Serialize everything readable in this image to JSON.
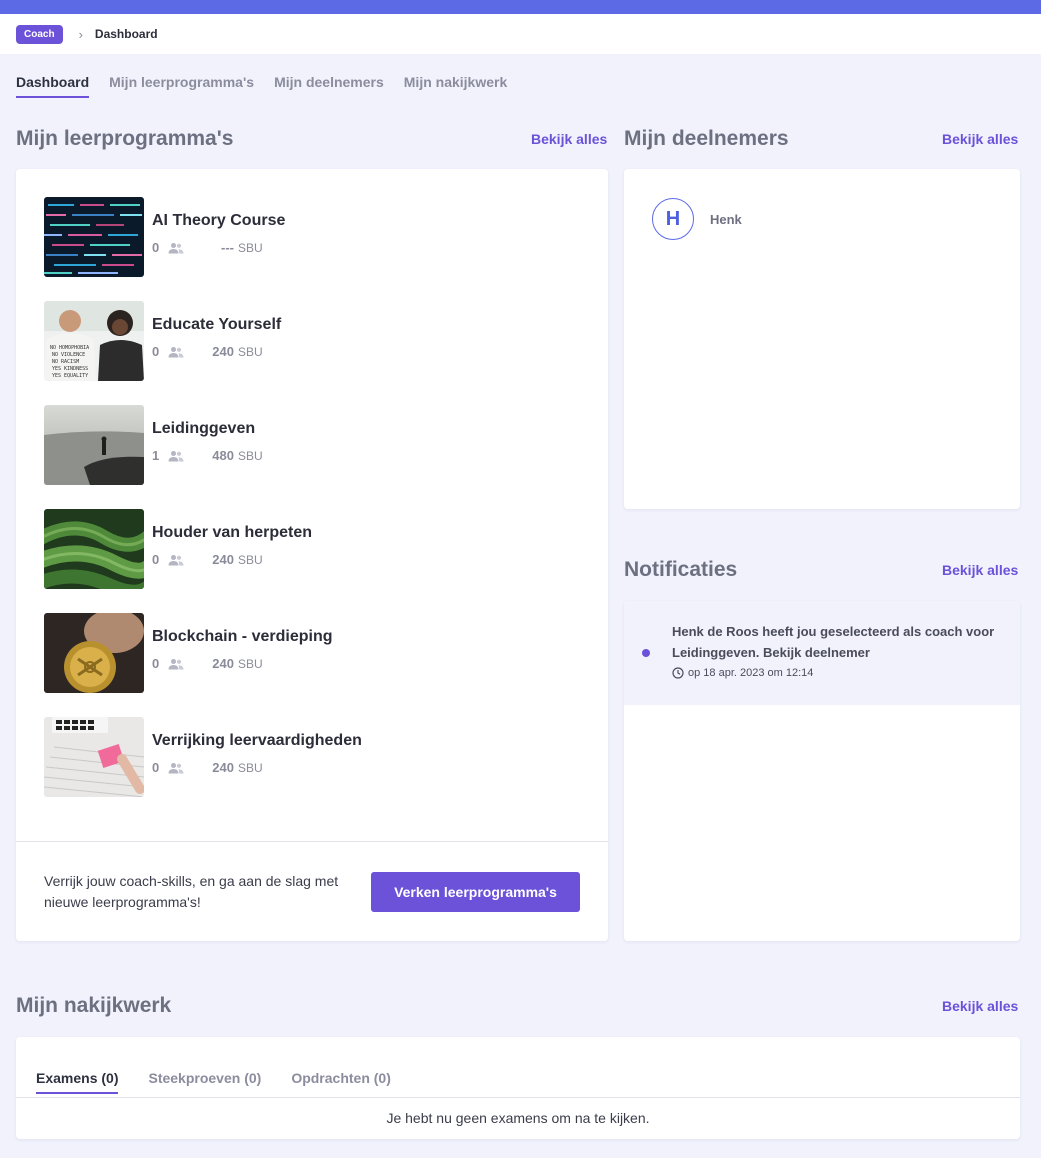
{
  "breadcrumb": {
    "role": "Coach",
    "separator": "›",
    "current": "Dashboard"
  },
  "tabs": [
    "Dashboard",
    "Mijn leerprogramma's",
    "Mijn deelnemers",
    "Mijn nakijkwerk"
  ],
  "programs_section": {
    "title": "Mijn leerprogramma's",
    "see_all": "Bekijk alles",
    "items": [
      {
        "title": "AI Theory Course",
        "participants": "0",
        "sbu": "---",
        "unit": "SBU"
      },
      {
        "title": "Educate Yourself",
        "participants": "0",
        "sbu": "240",
        "unit": "SBU"
      },
      {
        "title": "Leidinggeven",
        "participants": "1",
        "sbu": "480",
        "unit": "SBU"
      },
      {
        "title": "Houder van herpeten",
        "participants": "0",
        "sbu": "240",
        "unit": "SBU"
      },
      {
        "title": "Blockchain - verdieping",
        "participants": "0",
        "sbu": "240",
        "unit": "SBU"
      },
      {
        "title": "Verrijking leervaardigheden",
        "participants": "0",
        "sbu": "240",
        "unit": "SBU"
      }
    ],
    "cta_text": "Verrijk jouw coach-skills, en ga aan de slag met nieuwe leerprogramma's!",
    "cta_button": "Verken leerprogramma's"
  },
  "participants_section": {
    "title": "Mijn deelnemers",
    "see_all": "Bekijk alles",
    "items": [
      {
        "initial": "H",
        "name": "Henk"
      }
    ]
  },
  "notifications_section": {
    "title": "Notificaties",
    "see_all": "Bekijk alles",
    "items": [
      {
        "text": "Henk de Roos heeft jou geselecteerd als coach voor Leidinggeven. Bekijk deelnemer",
        "time": "op 18 apr. 2023 om 12:14"
      }
    ]
  },
  "review_section": {
    "title": "Mijn nakijkwerk",
    "see_all": "Bekijk alles",
    "tabs": [
      "Examens (0)",
      "Steekproeven (0)",
      "Opdrachten (0)"
    ],
    "empty_message": "Je hebt nu geen examens om na te kijken."
  },
  "colors": {
    "accent": "#6b52d9",
    "topbar": "#5c6ae6",
    "background": "#f1f2fc"
  },
  "icons": {
    "people": "people-icon",
    "clock": "clock-icon",
    "chevron": "chevron-right-icon"
  }
}
